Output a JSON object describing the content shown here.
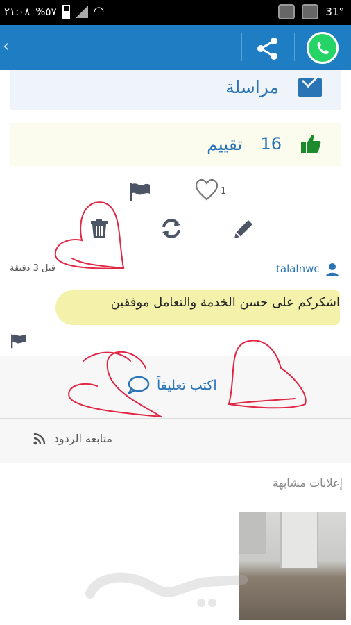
{
  "status_bar": {
    "time": "٢١:٠٨",
    "battery": "%٥٧",
    "temperature": "31°"
  },
  "icons": {
    "back": "chevron-left-icon",
    "share": "share-icon",
    "whatsapp": "whatsapp-icon",
    "envelope": "envelope-icon",
    "thumb": "thumbs-up-icon",
    "heart": "heart-icon",
    "flag": "flag-icon",
    "trash": "trash-icon",
    "refresh": "refresh-icon",
    "edit": "pencil-icon",
    "user": "user-icon",
    "chat": "chat-bubble-icon",
    "rss": "rss-icon"
  },
  "colors": {
    "appbar": "#1f7ec3",
    "accent": "#2a74b6",
    "thumb": "#1e8a2e",
    "scribble": "#e02545"
  },
  "message_card": {
    "label": "مراسلة"
  },
  "rating_card": {
    "count": "16",
    "label": "تقييم"
  },
  "actions": {
    "likes": "1"
  },
  "comment": {
    "username": "talalnwc",
    "time": "قبل 3 دقيقة",
    "text": "اشكركم على حسن الخدمة والتعامل موفقين"
  },
  "write_comment": {
    "label": "اكتب تعليقاً"
  },
  "follow_replies": {
    "label": "متابعة الردود"
  },
  "similar_ads": {
    "heading": "إعلانات مشابهة"
  }
}
